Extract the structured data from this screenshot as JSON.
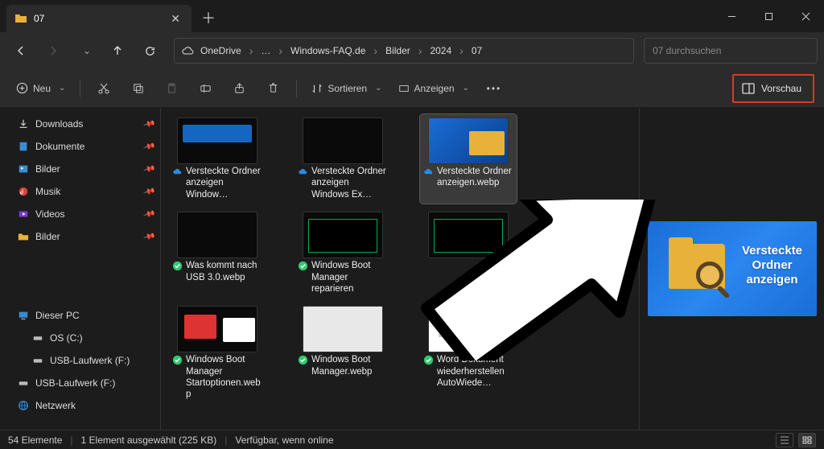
{
  "tab": {
    "title": "07"
  },
  "breadcrumb": {
    "root": "OneDrive",
    "items": [
      "Windows-FAQ.de",
      "Bilder",
      "2024",
      "07"
    ],
    "ellipsis": "…"
  },
  "search": {
    "placeholder": "07 durchsuchen"
  },
  "toolbar": {
    "new": "Neu",
    "sort": "Sortieren",
    "view": "Anzeigen",
    "preview": "Vorschau"
  },
  "sidebar": {
    "quick": [
      {
        "icon": "download",
        "label": "Downloads",
        "pinned": true
      },
      {
        "icon": "doc",
        "label": "Dokumente",
        "pinned": true
      },
      {
        "icon": "pic",
        "label": "Bilder",
        "pinned": true
      },
      {
        "icon": "music",
        "label": "Musik",
        "pinned": true
      },
      {
        "icon": "video",
        "label": "Videos",
        "pinned": true
      },
      {
        "icon": "folder",
        "label": "Bilder",
        "pinned": true
      }
    ],
    "devices": [
      {
        "icon": "pc",
        "label": "Dieser PC",
        "indent": 0
      },
      {
        "icon": "drive",
        "label": "OS (C:)",
        "indent": 1
      },
      {
        "icon": "drive",
        "label": "USB-Laufwerk (F:)",
        "indent": 1
      },
      {
        "icon": "drive",
        "label": "USB-Laufwerk (F:)",
        "indent": 0
      },
      {
        "icon": "net",
        "label": "Netzwerk",
        "indent": 0
      }
    ]
  },
  "files": [
    {
      "name": "Versteckte Ordner anzeigen Window…",
      "sync": "cloud",
      "thumb": "bluehdr",
      "selected": false
    },
    {
      "name": "Versteckte Ordner anzeigen Windows Ex…",
      "sync": "cloud",
      "thumb": "dark",
      "selected": false
    },
    {
      "name": "Versteckte Ordner anzeigen.webp",
      "sync": "cloud",
      "thumb": "desktop",
      "selected": true
    },
    {
      "name": "Was kommt nach USB 3.0.webp",
      "sync": "green",
      "thumb": "dark",
      "selected": false
    },
    {
      "name": "Windows Boot Manager reparieren",
      "sync": "green",
      "thumb": "cmd",
      "selected": false
    },
    {
      "name": "",
      "sync": "",
      "thumb": "cmd",
      "selected": false
    },
    {
      "name": "Windows Boot Manager Startoptionen.webp",
      "sync": "green",
      "thumb": "screens",
      "selected": false
    },
    {
      "name": "Windows Boot Manager.webp",
      "sync": "green",
      "thumb": "light",
      "selected": false
    },
    {
      "name": "Word Dokument wiederherstellen AutoWiede…",
      "sync": "green",
      "thumb": "doc",
      "selected": false
    }
  ],
  "preview": {
    "text": "Versteckte Ordner anzeigen"
  },
  "status": {
    "count": "54 Elemente",
    "selection": "1 Element ausgewählt (225 KB)",
    "availability": "Verfügbar, wenn online"
  }
}
